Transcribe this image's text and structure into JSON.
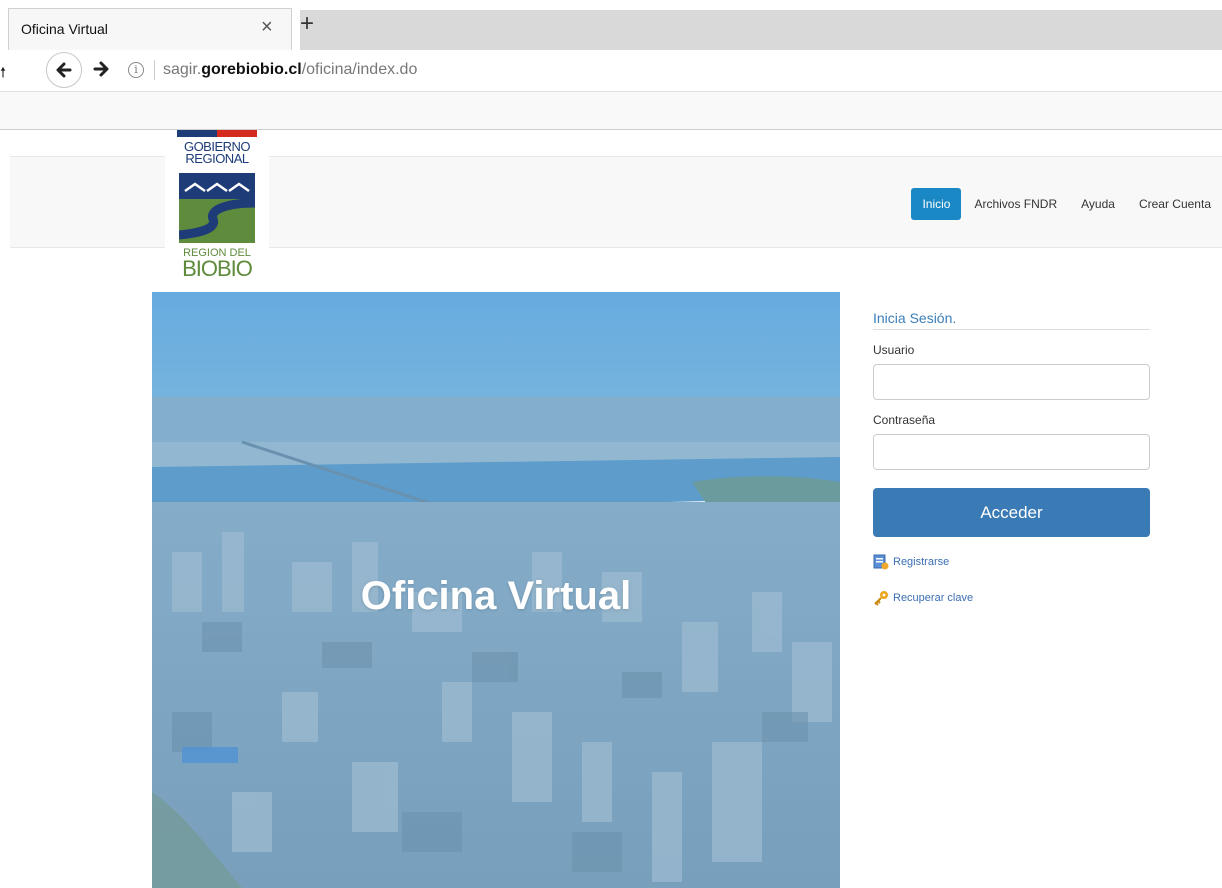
{
  "browser": {
    "tab_title": "Oficina Virtual",
    "close_glyph": "×",
    "new_tab_glyph": "+",
    "url_prefix": "sagir.",
    "url_domain": "gorebiobio.cl",
    "url_path": "/oficina/index.do",
    "info_glyph": "i",
    "nav_stub_glyph": "🠕"
  },
  "logo": {
    "line1": "GOBIERNO",
    "line2": "REGIONAL",
    "line3": "REGION DEL",
    "line4": "BIOBIO",
    "colors": {
      "blue": "#1d3c78",
      "red": "#d52b1e",
      "green": "#5f8b3c"
    }
  },
  "nav": {
    "items": [
      {
        "label": "Inicio",
        "active": true
      },
      {
        "label": "Archivos FNDR",
        "active": false
      },
      {
        "label": "Ayuda",
        "active": false
      },
      {
        "label": "Crear Cuenta",
        "active": false
      }
    ],
    "accent": "#1b88c6"
  },
  "hero": {
    "title": "Oficina Virtual"
  },
  "login": {
    "title": "Inicia Sesión.",
    "user_label": "Usuario",
    "user_value": "",
    "password_label": "Contraseña",
    "password_value": "",
    "submit_label": "Acceder",
    "register_label": "Registrarse",
    "recover_label": "Recuperar clave",
    "accent": "#3a7ab5"
  }
}
